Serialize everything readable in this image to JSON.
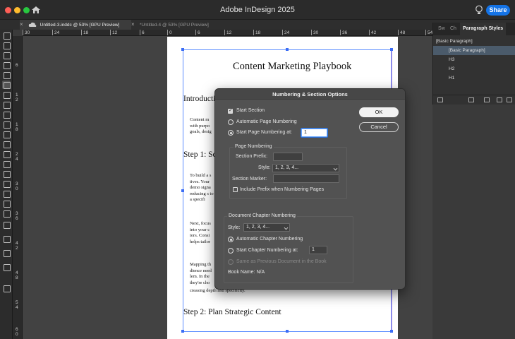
{
  "window": {
    "title": "Adobe InDesign 2025",
    "share_label": "Share"
  },
  "tabs": [
    {
      "label": "Untitled-3.inddc @ 53% [GPU Preview]",
      "close": "×"
    },
    {
      "label": "*Untitled-4 @ 53% [GPU Preview]",
      "close": "×"
    }
  ],
  "ruler": {
    "h_ticks": [
      "30",
      "24",
      "18",
      "12",
      "6",
      "0",
      "6",
      "12",
      "18",
      "24",
      "30",
      "36",
      "42",
      "48",
      "54"
    ],
    "v_ticks": [
      "6",
      "1\n2",
      "1\n8",
      "2\n4",
      "3\n0",
      "3\n6",
      "4\n2",
      "4\n8",
      "5\n4",
      "6\n0"
    ]
  },
  "document": {
    "title": "Content Marketing Playbook",
    "heading_intro": "Introducti",
    "body_intro": "Content m with purpo goals, desig",
    "heading_step1": "Step 1: Sc",
    "body_step1": "To build a s tives. Your demo signa reducing s to a specifi",
    "body_next": "Next, focus into your c iors. Consi helps tailor",
    "body_mapping": "Mapping th dience need lem. In the they're cho",
    "body_trail": "creasing depth and specificity.",
    "heading_step2": "Step 2: Plan Strategic Content"
  },
  "panel": {
    "tab_sw": "Sw",
    "tab_ch": "Ch",
    "tab_paragraph": "Paragraph Styles",
    "current_style": "[Basic Paragraph]",
    "styles": [
      "[Basic Paragraph]",
      "H3",
      "H2",
      "H1"
    ]
  },
  "dialog": {
    "title": "Numbering & Section Options",
    "start_section": "Start Section",
    "auto_page_numbering": "Automatic Page Numbering",
    "start_page_numbering_at": "Start Page Numbering at:",
    "start_page_value": "1",
    "page_numbering_group": "Page Numbering",
    "section_prefix_label": "Section Prefix:",
    "section_prefix_value": "",
    "style_label": "Style:",
    "style_value": "1, 2, 3, 4...",
    "section_marker_label": "Section Marker:",
    "section_marker_value": "",
    "include_prefix": "Include Prefix when Numbering Pages",
    "chapter_group": "Document Chapter Numbering",
    "chapter_style_label": "Style:",
    "chapter_style_value": "1, 2, 3, 4...",
    "auto_chapter_numbering": "Automatic Chapter Numbering",
    "start_chapter_numbering_at": "Start Chapter Numbering at:",
    "start_chapter_value": "1",
    "same_as_previous": "Same as Previous Document in the Book",
    "book_name": "Book Name: N/A",
    "ok_label": "OK",
    "cancel_label": "Cancel",
    "state": {
      "start_section": true,
      "page_numbering_mode": "start_at",
      "include_prefix": false,
      "chapter_numbering_mode": "automatic"
    }
  },
  "colors": {
    "accent": "#1473e6",
    "selection": "#5c8dff",
    "margin_guide": "#c98ad1"
  }
}
